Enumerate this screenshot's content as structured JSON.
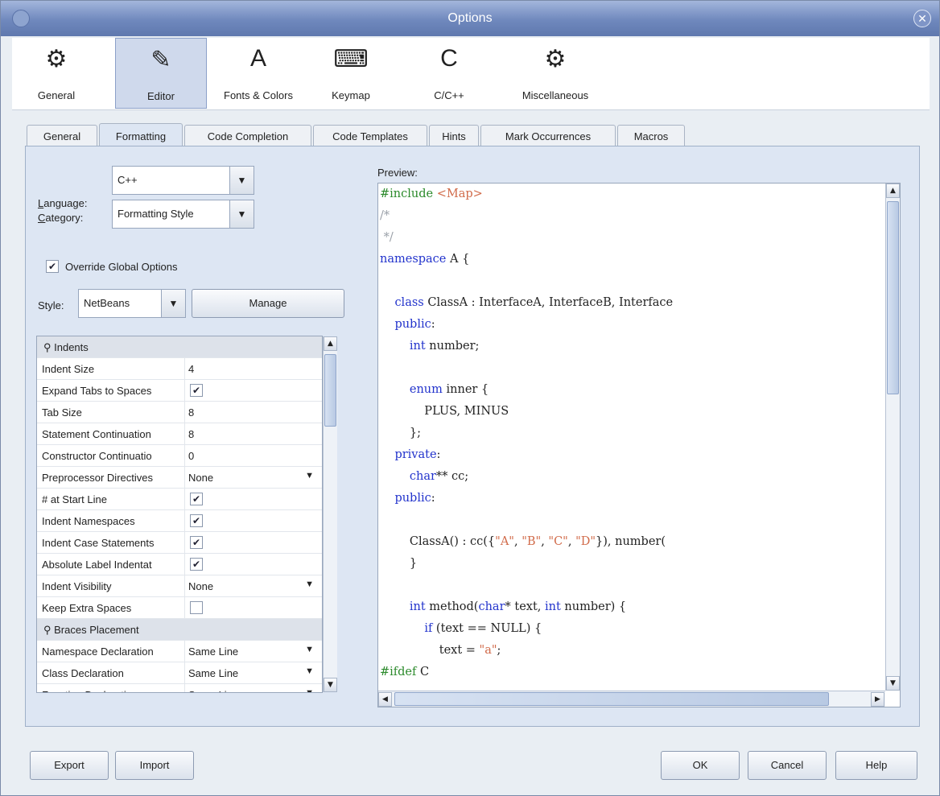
{
  "window": {
    "title": "Options"
  },
  "categories": [
    {
      "label": "General",
      "icon": "wrench-gears-icon",
      "glyph": "⚙"
    },
    {
      "label": "Editor",
      "icon": "book-pencil-icon",
      "glyph": "✎"
    },
    {
      "label": "Fonts & Colors",
      "icon": "letter-a-palette-icon",
      "glyph": "A"
    },
    {
      "label": "Keymap",
      "icon": "keyboard-keys-icon",
      "glyph": "⌨"
    },
    {
      "label": "C/C++",
      "icon": "cpp-logo-icon",
      "glyph": "C"
    },
    {
      "label": "Miscellaneous",
      "icon": "misc-gear-icon",
      "glyph": "⚙"
    }
  ],
  "selected_category": "Editor",
  "tabs": [
    "General",
    "Formatting",
    "Code Completion",
    "Code Templates",
    "Hints",
    "Mark Occurrences",
    "Macros"
  ],
  "selected_tab": "Formatting",
  "form": {
    "language_label": "Language:",
    "language_value": "C++",
    "category_label": "Category:",
    "category_value": "Formatting Style",
    "override_label": "Override Global Options",
    "override_checked": true,
    "style_label": "Style:",
    "style_value": "NetBeans",
    "manage_label": "Manage"
  },
  "properties": [
    {
      "type": "group",
      "label": "Indents"
    },
    {
      "key": "Indent Size",
      "value": "4"
    },
    {
      "key": "Expand Tabs to Spaces",
      "check": true
    },
    {
      "key": "Tab Size",
      "value": "8"
    },
    {
      "key": "Statement Continuation",
      "value": "8"
    },
    {
      "key": "Constructor Continuatio",
      "value": "0"
    },
    {
      "key": "Preprocessor Directives",
      "value": "None",
      "dropdown": true
    },
    {
      "key": "# at Start Line",
      "check": true
    },
    {
      "key": "Indent Namespaces",
      "check": true
    },
    {
      "key": "Indent Case Statements",
      "check": true
    },
    {
      "key": "Absolute Label Indentat",
      "check": true
    },
    {
      "key": "Indent Visibility",
      "value": "None",
      "dropdown": true
    },
    {
      "key": "Keep Extra Spaces",
      "check": false
    },
    {
      "type": "group",
      "label": "Braces Placement"
    },
    {
      "key": "Namespace Declaration",
      "value": "Same Line",
      "dropdown": true
    },
    {
      "key": "Class Declaration",
      "value": "Same Line",
      "dropdown": true
    },
    {
      "key": "Function Declaration",
      "value": "Same Line",
      "dropdown": true
    }
  ],
  "preview": {
    "label": "Preview:",
    "lines": [
      [
        [
          "pp",
          "#include "
        ],
        [
          "st",
          "<Map>"
        ]
      ],
      [
        [
          "cm",
          "/*"
        ]
      ],
      [
        [
          "cm",
          " */"
        ]
      ],
      [
        [
          "kw",
          "namespace"
        ],
        [
          "",
          " A {"
        ]
      ],
      [
        [
          "",
          ""
        ]
      ],
      [
        [
          "",
          "    "
        ],
        [
          "kw",
          "class"
        ],
        [
          "",
          " ClassA : InterfaceA, InterfaceB, Interface"
        ]
      ],
      [
        [
          "",
          "    "
        ],
        [
          "kw",
          "public"
        ],
        [
          "",
          ":"
        ]
      ],
      [
        [
          "",
          "        "
        ],
        [
          "kw",
          "int"
        ],
        [
          "",
          " number;"
        ]
      ],
      [
        [
          "",
          ""
        ]
      ],
      [
        [
          "",
          "        "
        ],
        [
          "kw",
          "enum"
        ],
        [
          "",
          " inner {"
        ]
      ],
      [
        [
          "",
          "            PLUS, MINUS"
        ]
      ],
      [
        [
          "",
          "        };"
        ]
      ],
      [
        [
          "",
          "    "
        ],
        [
          "kw",
          "private"
        ],
        [
          "",
          ":"
        ]
      ],
      [
        [
          "",
          "        "
        ],
        [
          "kw",
          "char"
        ],
        [
          "",
          "** cc;"
        ]
      ],
      [
        [
          "",
          "    "
        ],
        [
          "kw",
          "public"
        ],
        [
          "",
          ":"
        ]
      ],
      [
        [
          "",
          ""
        ]
      ],
      [
        [
          "",
          "        ClassA() : cc({"
        ],
        [
          "st",
          "\"A\""
        ],
        [
          "",
          ", "
        ],
        [
          "st",
          "\"B\""
        ],
        [
          "",
          ", "
        ],
        [
          "st",
          "\"C\""
        ],
        [
          "",
          ", "
        ],
        [
          "st",
          "\"D\""
        ],
        [
          "",
          "}), number("
        ]
      ],
      [
        [
          "",
          "        }"
        ]
      ],
      [
        [
          "",
          ""
        ]
      ],
      [
        [
          "",
          "        "
        ],
        [
          "kw",
          "int"
        ],
        [
          "",
          " method("
        ],
        [
          "kw",
          "char"
        ],
        [
          "",
          "* text, "
        ],
        [
          "kw",
          "int"
        ],
        [
          "",
          " number) {"
        ]
      ],
      [
        [
          "",
          "            "
        ],
        [
          "kw",
          "if"
        ],
        [
          "",
          " (text == NULL) {"
        ]
      ],
      [
        [
          "",
          "                text = "
        ],
        [
          "st",
          "\"a\""
        ],
        [
          "",
          ";"
        ]
      ],
      [
        [
          "pp",
          "#ifdef"
        ],
        [
          "",
          " C"
        ]
      ]
    ]
  },
  "buttons": {
    "export": "Export",
    "import": "Import",
    "ok": "OK",
    "cancel": "Cancel",
    "help": "Help"
  },
  "colors": {
    "keyword": "#2233cc",
    "preprocessor": "#2b8a2b",
    "comment": "#9aa0a8",
    "string": "#d16b4a",
    "title_bar": "#6f88bd"
  }
}
